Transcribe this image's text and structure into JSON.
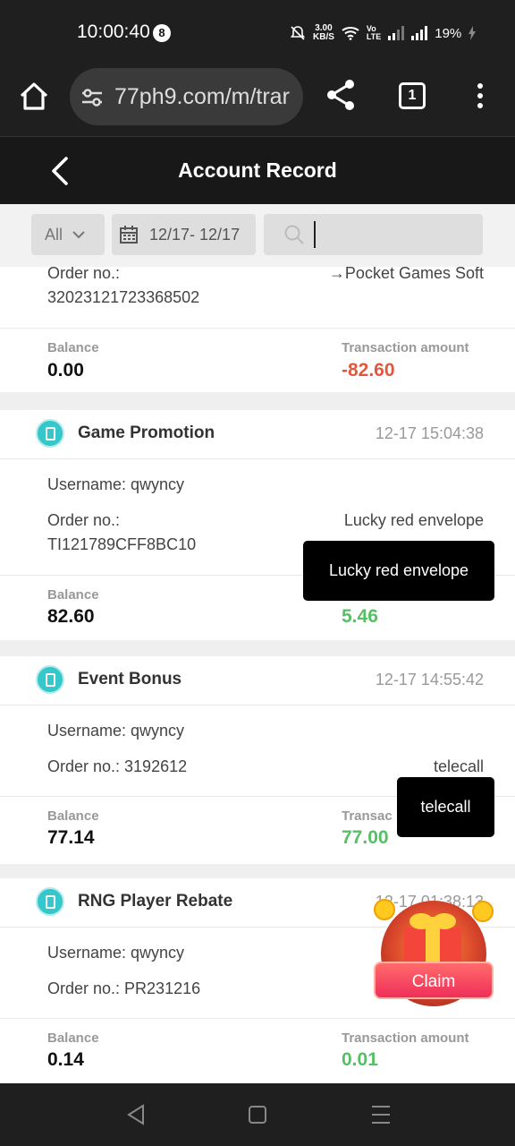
{
  "status_bar": {
    "time": "10:00:40",
    "notif_count": "8",
    "net_speed": "3.00",
    "net_speed_unit": "KB/S",
    "volte_top": "Vo",
    "volte_bottom": "LTE",
    "battery": "19%"
  },
  "browser": {
    "url": "77ph9.com/m/trar",
    "tab_count": "1"
  },
  "header": {
    "title": "Account Record"
  },
  "filters": {
    "type_value": "All",
    "date_range": "12/17- 12/17",
    "search_value": ""
  },
  "records": [
    {
      "order_label": "Order no.:",
      "order_no": "32023121723368502",
      "detail": "→Pocket Games Soft",
      "balance_label": "Balance",
      "balance": "0.00",
      "amount_label": "Transaction amount",
      "amount": "-82.60",
      "amount_sign": "negative"
    },
    {
      "title": "Game Promotion",
      "time": "12-17 15:04:38",
      "username": "Username: qwyncy",
      "order_label": "Order no.:",
      "order_no": "TI121789CFF8BC10",
      "detail": "Lucky red envelope",
      "tooltip": "Lucky red envelope",
      "balance_label": "Balance",
      "balance": "82.60",
      "amount": "5.46",
      "amount_sign": "positive"
    },
    {
      "title": "Event Bonus",
      "time": "12-17 14:55:42",
      "username": "Username: qwyncy",
      "order_line": "Order no.: 3192612",
      "detail": "telecall",
      "tooltip": "telecall",
      "balance_label": "Balance",
      "balance": "77.14",
      "amount_label_partial": "Transac",
      "amount": "77.00",
      "amount_sign": "positive"
    },
    {
      "title": "RNG Player Rebate",
      "time": "12-17 01:38:13",
      "username": "Username: qwyncy",
      "order_line": "Order no.: PR231216",
      "balance_label": "Balance",
      "balance": "0.14",
      "amount_label": "Transaction amount",
      "amount": "0.01",
      "amount_sign": "positive"
    }
  ],
  "claim_widget": {
    "label": "Claim"
  },
  "icons": {
    "record": "receipt-icon",
    "search": "search-icon",
    "calendar": "calendar-icon"
  },
  "colors": {
    "negative": "#e2583e",
    "positive": "#55c064",
    "record_icon": "#35c7c9"
  }
}
